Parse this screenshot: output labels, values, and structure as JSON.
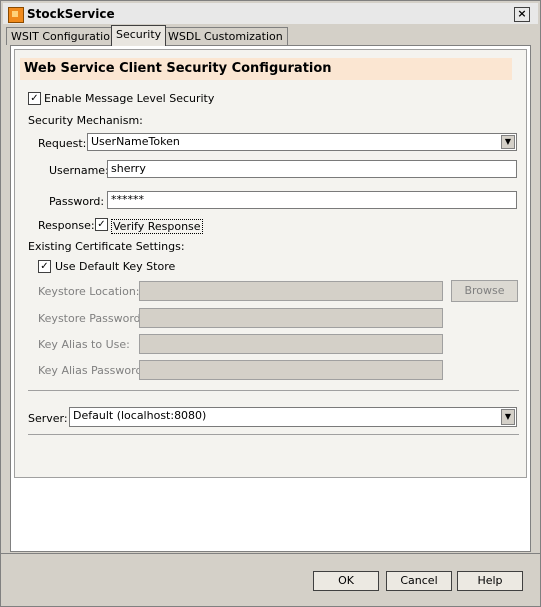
{
  "window": {
    "title": "StockService",
    "close_label": "×"
  },
  "tabs": [
    {
      "label": "WSIT Configuration"
    },
    {
      "label": "Security"
    },
    {
      "label": "WSDL Customization"
    }
  ],
  "panel": {
    "heading": "Web Service Client Security Configuration",
    "enable_message_security": {
      "label": "Enable Message Level Security",
      "checked": true
    },
    "security_mechanism_label": "Security Mechanism:",
    "request": {
      "label": "Request:",
      "value": "UserNameToken"
    },
    "username": {
      "label": "Username:",
      "value": "sherry"
    },
    "password": {
      "label": "Password:",
      "value": "******"
    },
    "response": {
      "label": "Response:",
      "verify_label": "Verify Response",
      "checked": true
    },
    "existing_cert_label": "Existing Certificate Settings:",
    "use_default_keystore": {
      "label": "Use Default Key Store",
      "checked": true
    },
    "keystore_location": {
      "label": "Keystore Location:",
      "value": ""
    },
    "browse_label": "Browse",
    "keystore_password": {
      "label": "Keystore Password:",
      "value": ""
    },
    "key_alias": {
      "label": "Key Alias to Use:",
      "value": ""
    },
    "key_alias_password": {
      "label": "Key Alias Password:",
      "value": ""
    },
    "server": {
      "label": "Server:",
      "value": "Default (localhost:8080)"
    }
  },
  "footer": {
    "ok_label": "OK",
    "cancel_label": "Cancel",
    "help_label": "Help"
  }
}
